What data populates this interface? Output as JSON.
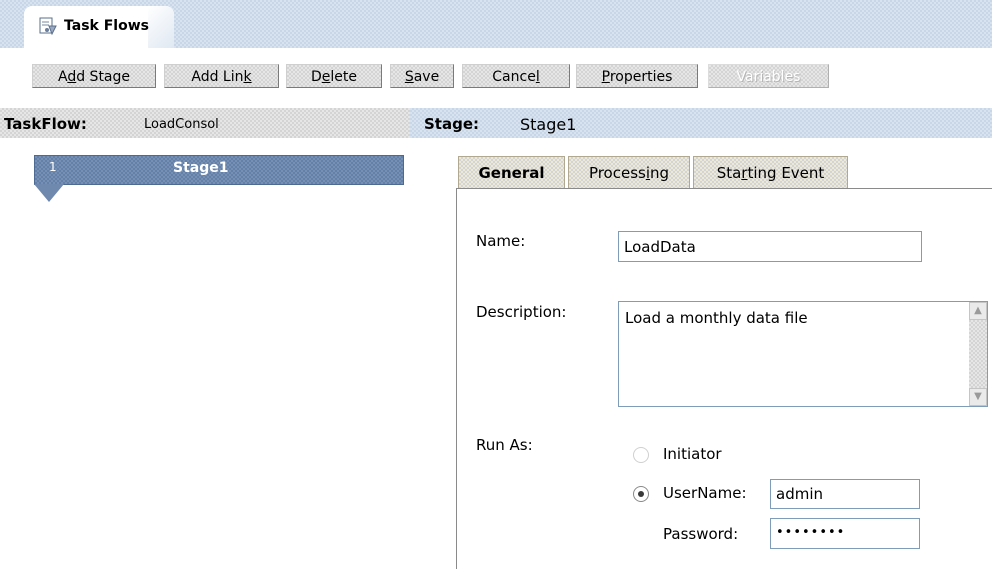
{
  "app": {
    "title": "Task Flows",
    "title_icon": "taskflow-document-icon"
  },
  "toolbar": {
    "buttons": [
      {
        "pre": "A",
        "u": "d",
        "post": "d Stage",
        "enabled": true
      },
      {
        "pre": "Add Lin",
        "u": "k",
        "post": "",
        "enabled": true
      },
      {
        "pre": "D",
        "u": "e",
        "post": "lete",
        "enabled": true
      },
      {
        "pre": "",
        "u": "S",
        "post": "ave",
        "enabled": true
      },
      {
        "pre": "Cance",
        "u": "l",
        "post": "",
        "enabled": true
      },
      {
        "pre": "",
        "u": "P",
        "post": "roperties",
        "enabled": true
      },
      {
        "pre": "Variables",
        "u": "",
        "post": "",
        "enabled": false
      }
    ]
  },
  "taskflow": {
    "label": "TaskFlow:",
    "value": "LoadConsol"
  },
  "stage_header": {
    "label": "Stage:",
    "value": "Stage1"
  },
  "stage_node": {
    "number": "1",
    "name": "Stage1"
  },
  "tabs": [
    {
      "pre": "General",
      "u": "",
      "post": "",
      "active": true
    },
    {
      "pre": "Process",
      "u": "i",
      "post": "ng",
      "active": false
    },
    {
      "pre": "Sta",
      "u": "r",
      "post": "ting Event",
      "active": false
    }
  ],
  "form": {
    "name_label": "Name:",
    "name_value": "LoadData",
    "description_label": "Description:",
    "description_value": "Load a monthly data file",
    "run_as_label": "Run As:",
    "initiator_label": "Initiator",
    "initiator_checked": false,
    "username_label": "UserName:",
    "username_value": "admin",
    "username_checked": true,
    "password_label": "Password:",
    "password_value": "••••••••"
  },
  "colors": {
    "header_bg": "#d7e3f0",
    "stage_bar": "#7690b4",
    "tab_bg": "#ece9d8",
    "input_border": "#7f9db9"
  }
}
